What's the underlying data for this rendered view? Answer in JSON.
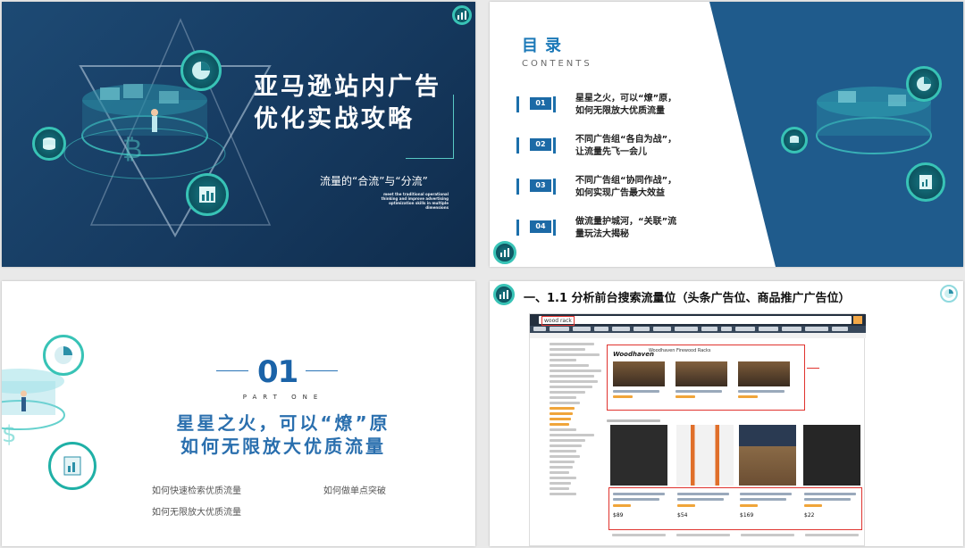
{
  "slide1": {
    "title_line1": "亚马逊站内广告",
    "title_line2": "优化实战攻略",
    "subtitle": "流量的“合流”与“分流”",
    "tiny_text": "meet the traditional operational thinking and improve advertising optimization skills in multiple dimensions"
  },
  "slide2": {
    "title": "目录",
    "subtitle_en": "CONTENTS",
    "items": [
      {
        "num": "01",
        "line1": "星星之火，可以“燎”原，",
        "line2": "如何无限放大优质流量"
      },
      {
        "num": "02",
        "line1": "不同广告组“各自为战”，",
        "line2": "让流量先飞一会儿"
      },
      {
        "num": "03",
        "line1": "不同广告组“协同作战”，",
        "line2": "如何实现广告最大效益"
      },
      {
        "num": "04",
        "line1": "做流量护城河，“关联”流",
        "line2": "量玩法大揭秘"
      }
    ]
  },
  "slide3": {
    "number": "01",
    "part": "PART ONE",
    "heading_line1": "星星之火，可以“燎”原",
    "heading_line2": "如何无限放大优质流量",
    "links": [
      "如何快速检索优质流量",
      "如何做单点突破",
      "如何无限放大优质流量"
    ]
  },
  "slide4": {
    "title": "一、1.1 分析前台搜索流量位（头条广告位、商品推广广告位）",
    "search_value": "wood rack",
    "brand": "Woodhaven",
    "banner_title": "Woodhaven Firewood Racks",
    "prices": [
      "$89",
      "$54",
      "$169",
      "$22"
    ]
  },
  "colors": {
    "dark_blue": "#163a60",
    "accent_teal": "#38c3b6",
    "brand_blue": "#1c6aa6",
    "amazon_dark": "#232f3e",
    "highlight_red": "#e0332e"
  }
}
